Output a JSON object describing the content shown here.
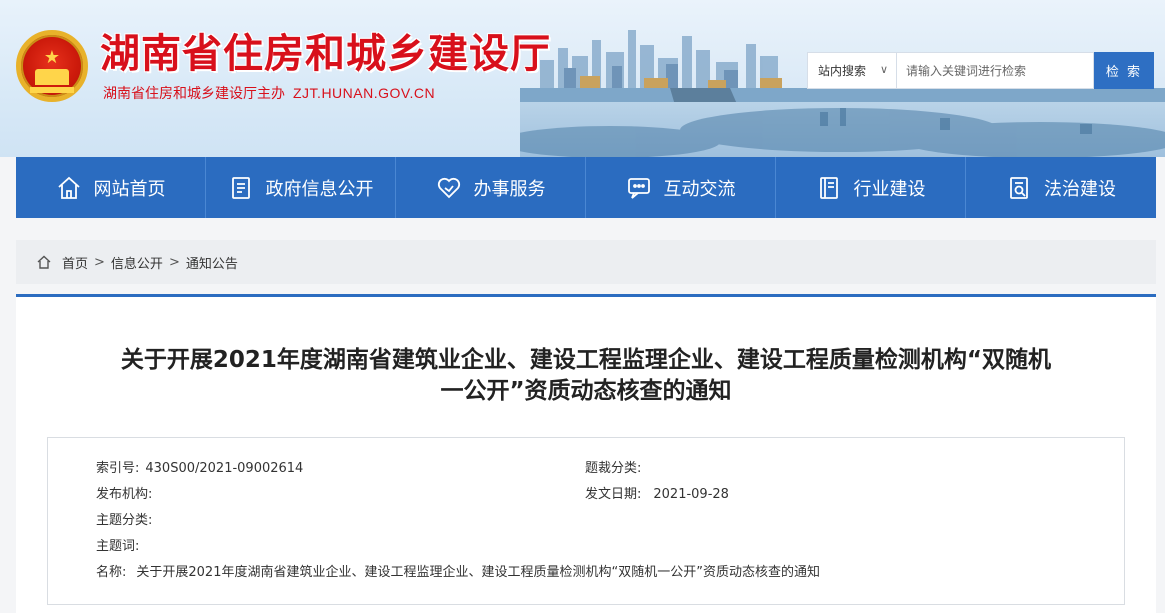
{
  "header": {
    "title": "湖南省住房和城乡建设厅",
    "subtitle": "湖南省住房和城乡建设厅主办",
    "domain": "ZJT.HUNAN.GOV.CN",
    "search": {
      "scope": "站内搜索",
      "placeholder": "请输入关键词进行检索",
      "button": "检 索"
    }
  },
  "nav": [
    {
      "label": "网站首页",
      "icon": "home-icon"
    },
    {
      "label": "政府信息公开",
      "icon": "document-icon"
    },
    {
      "label": "办事服务",
      "icon": "heart-icon"
    },
    {
      "label": "互动交流",
      "icon": "chat-icon"
    },
    {
      "label": "行业建设",
      "icon": "book-icon"
    },
    {
      "label": "法治建设",
      "icon": "law-icon"
    }
  ],
  "breadcrumb": [
    "首页",
    "信息公开",
    "通知公告"
  ],
  "article": {
    "title_line1": "关于开展2021年度湖南省建筑业企业、建设工程监理企业、建设工程质量检测机构“双随机",
    "title_line2": "一公开”资质动态核查的通知",
    "meta": {
      "index_label": "索引号:",
      "index_value": "430S00/2021-09002614",
      "genre_label": "题裁分类:",
      "genre_value": "",
      "org_label": "发布机构:",
      "org_value": "",
      "date_label": "发文日期:",
      "date_value": "2021-09-28",
      "topic_label": "主题分类:",
      "topic_value": "",
      "keywords_label": "主题词:",
      "keywords_value": "",
      "name_label": "名称:",
      "name_value": "关于开展2021年度湖南省建筑业企业、建设工程监理企业、建设工程质量检测机构“双随机一公开”资质动态核查的通知"
    }
  },
  "colors": {
    "brand_red": "#d8101b",
    "nav_blue": "#2b6cc0",
    "search_button": "#2e6fc3"
  }
}
